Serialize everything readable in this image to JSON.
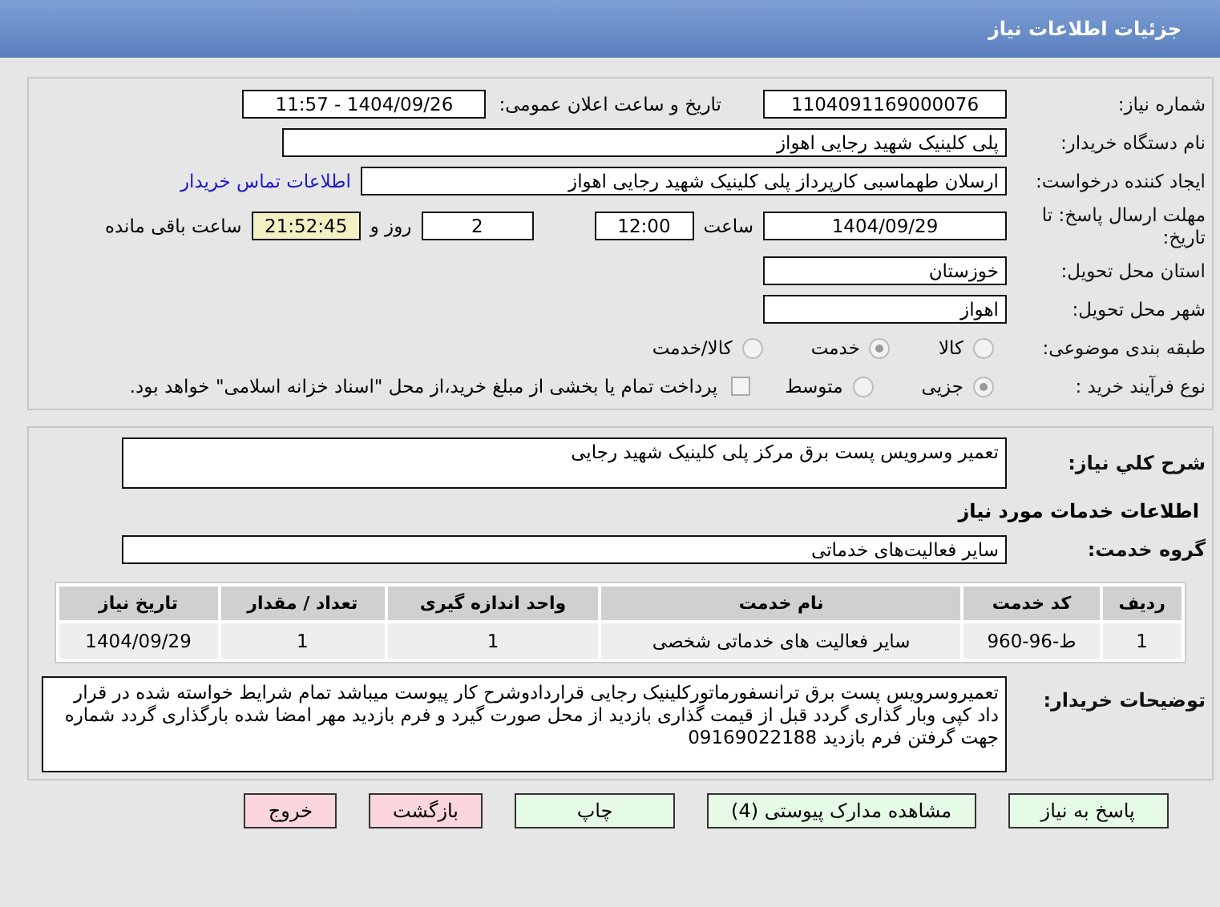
{
  "header": {
    "title": "جزئیات اطلاعات نیاز"
  },
  "need_number": {
    "label": "شماره نیاز:",
    "value": "1104091169000076"
  },
  "announce": {
    "label": "تاریخ و ساعت اعلان عمومی:",
    "value": "1404/09/26 - 11:57"
  },
  "buyer": {
    "label": "نام دستگاه خریدار:",
    "value": "پلی کلینیک شهید رجایی اهواز"
  },
  "creator": {
    "label": "ایجاد کننده درخواست:",
    "value": "ارسلان طهماسبی کارپرداز پلی کلینیک شهید رجایی اهواز",
    "link": "اطلاعات تماس خریدار"
  },
  "deadline": {
    "label": "مهلت ارسال پاسخ: تا تاریخ:",
    "date": "1404/09/29",
    "time_label": "ساعت",
    "time": "12:00",
    "days": "2",
    "days_label": "روز و",
    "remaining": "21:52:45",
    "remaining_label": "ساعت باقی مانده"
  },
  "province": {
    "label": "استان محل تحویل:",
    "value": "خوزستان"
  },
  "city": {
    "label": "شهر محل تحویل:",
    "value": "اهواز"
  },
  "category": {
    "label": "طبقه بندی موضوعی:",
    "options": [
      {
        "label": "کالا",
        "selected": false
      },
      {
        "label": "خدمت",
        "selected": true
      },
      {
        "label": "کالا/خدمت",
        "selected": false
      }
    ]
  },
  "process": {
    "label": "نوع فرآیند خرید :",
    "options": [
      {
        "label": "جزیی",
        "selected": true
      },
      {
        "label": "متوسط",
        "selected": false
      }
    ],
    "treasury": {
      "checked": false,
      "text": "پرداخت تمام یا بخشی از مبلغ خرید،از محل \"اسناد خزانه اسلامی\" خواهد بود."
    }
  },
  "description": {
    "label": "شرح کلي نياز:",
    "value": "تعمیر وسرویس پست برق مرکز پلی کلینیک شهید رجایی"
  },
  "services_title": "اطلاعات خدمات مورد نیاز",
  "service_group": {
    "label": "گروه خدمت:",
    "value": "سایر فعالیت‌های خدماتی"
  },
  "table": {
    "columns": [
      "ردیف",
      "کد خدمت",
      "نام خدمت",
      "واحد اندازه گیری",
      "تعداد / مقدار",
      "تاریخ نیاز"
    ],
    "rows": [
      [
        "1",
        "ط-96-960",
        "سایر فعالیت های خدماتی شخصی",
        "1",
        "1",
        "1404/09/29"
      ]
    ]
  },
  "notes": {
    "label": "توضیحات خریدار:",
    "value": "تعمیروسرویس پست برق ترانسفورماتورکلینیک رجایی قراردادوشرح کار پیوست میباشد تمام شرایط خواسته شده در قرار داد کپی وبار گذاری گردد قبل از قیمت گذاری بازدید از محل صورت گیرد و فرم بازدید مهر امضا شده بارگذاری گردد شماره جهت گرفتن فرم بازدید 09169022188"
  },
  "buttons": [
    {
      "label": "پاسخ به نیاز",
      "kind": "go"
    },
    {
      "label": "مشاهده مدارک پیوستی (4)",
      "kind": "go"
    },
    {
      "label": "چاپ",
      "kind": "go"
    },
    {
      "label": "بازگشت",
      "kind": "back"
    },
    {
      "label": "خروج",
      "kind": "back"
    }
  ]
}
